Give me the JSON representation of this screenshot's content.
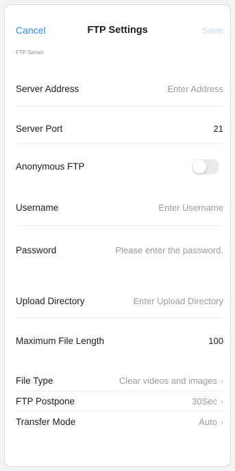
{
  "navbar": {
    "cancel_label": "Cancel",
    "title": "FTP Settings",
    "save_label": "Save"
  },
  "section": {
    "header": "FTP Server"
  },
  "fields": {
    "server_address": {
      "label": "Server Address",
      "placeholder": "Enter Address"
    },
    "server_port": {
      "label": "Server Port",
      "value": "21"
    },
    "anonymous_ftp": {
      "label": "Anonymous FTP",
      "enabled": false
    },
    "username": {
      "label": "Username",
      "placeholder": "Enter Username"
    },
    "password": {
      "label": "Password",
      "placeholder": "Please enter the password."
    },
    "upload_directory": {
      "label": "Upload Directory",
      "placeholder": "Enter Upload Directory"
    },
    "max_file_length": {
      "label": "Maximum File Length",
      "value": "100"
    },
    "file_type": {
      "label": "File Type",
      "value": "Clear videos and images"
    },
    "ftp_postpone": {
      "label": "FTP Postpone",
      "value": "30Sec"
    },
    "transfer_mode": {
      "label": "Transfer Mode",
      "value": "Auto"
    }
  },
  "icons": {
    "chevron": "chevron-right-icon"
  },
  "colors": {
    "accent": "#2f8ee0",
    "accent_disabled": "#c5dcf2",
    "placeholder": "#9a9aa0",
    "toggle_off": "#e9e9ec"
  }
}
